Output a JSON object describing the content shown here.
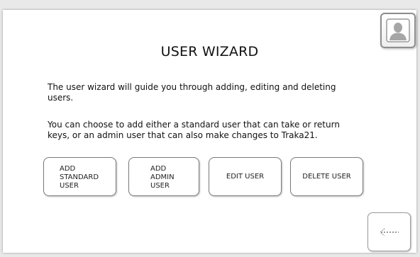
{
  "title": "USER WIZARD",
  "intro": {
    "paragraph1": "The user wizard will guide you through adding, editing and deleting users.",
    "paragraph2": "You can choose to add either a standard user that can take or return keys, or an admin user that can also make changes to Traka21."
  },
  "buttons": {
    "add_standard": [
      "ADD",
      "STANDARD",
      "USER"
    ],
    "add_admin": [
      "ADD",
      "ADMIN",
      "USER"
    ],
    "edit_user": "EDIT USER",
    "delete_user": "DELETE USER"
  },
  "icons": {
    "user": "user-silhouette-icon",
    "back": "dotted-back-arrow-icon"
  },
  "colors": {
    "background": "#ffffff",
    "border": "#7a7a7a",
    "icon_gray": "#a9a9a9"
  }
}
